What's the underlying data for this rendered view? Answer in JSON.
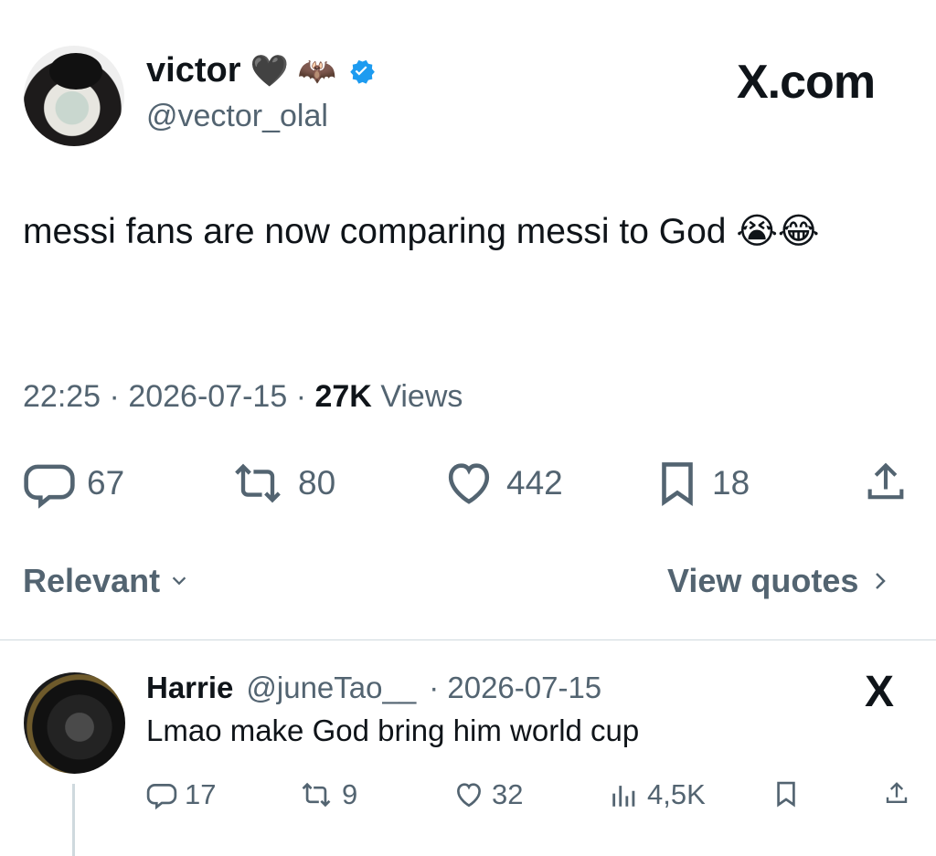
{
  "brand": {
    "label": "X.com"
  },
  "post": {
    "author": {
      "display_name": "victor",
      "emoji_badges": [
        "🖤",
        "🦇"
      ],
      "verified": true,
      "handle": "@vector_olal"
    },
    "text": "messi fans are now comparing messi to God 😭😂",
    "time": "22:25",
    "separator": "·",
    "date": "2026-07-15",
    "views_count": "27K",
    "views_label": "Views",
    "metrics": {
      "replies": "67",
      "reposts": "80",
      "likes": "442",
      "bookmarks": "18"
    }
  },
  "controls": {
    "sort_label": "Relevant",
    "view_quotes_label": "View quotes"
  },
  "reply": {
    "author_name": "Harrie",
    "author_handle": "@juneTao__",
    "date": "· 2026-07-15",
    "text": "Lmao make God bring him world cup",
    "metrics": {
      "replies": "17",
      "reposts": "9",
      "likes": "32",
      "views": "4,5K"
    },
    "brand_icon": "X"
  }
}
